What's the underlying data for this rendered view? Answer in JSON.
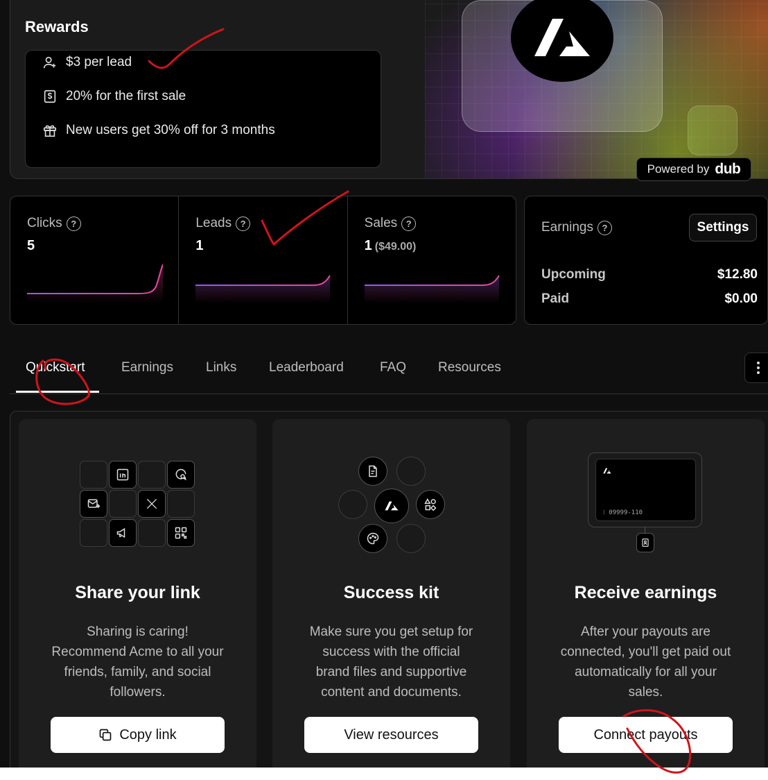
{
  "rewards": {
    "title": "Rewards",
    "items": [
      {
        "icon": "user-plus-icon",
        "text": "$3 per lead"
      },
      {
        "icon": "receipt-dollar-icon",
        "text": "20% for the first sale"
      },
      {
        "icon": "gift-icon",
        "text": "New users get 30% off for 3 months"
      }
    ]
  },
  "powered_by": {
    "label": "Powered by",
    "brand": "dub"
  },
  "stats": [
    {
      "label": "Clicks",
      "value": "5",
      "sub": ""
    },
    {
      "label": "Leads",
      "value": "1",
      "sub": ""
    },
    {
      "label": "Sales",
      "value": "1",
      "sub": "($49.00)"
    }
  ],
  "earnings": {
    "label": "Earnings",
    "settings_label": "Settings",
    "upcoming_label": "Upcoming",
    "upcoming_value": "$12.80",
    "paid_label": "Paid",
    "paid_value": "$0.00"
  },
  "tabs": [
    "Quickstart",
    "Earnings",
    "Links",
    "Leaderboard",
    "FAQ",
    "Resources"
  ],
  "active_tab": "Quickstart",
  "cards": [
    {
      "title": "Share your link",
      "desc": "Sharing is caring! Recommend Acme to all your friends, family, and social followers.",
      "button": "Copy link",
      "button_icon": "copy-icon"
    },
    {
      "title": "Success kit",
      "desc": "Make sure you get setup for success with the official brand files and supportive content and documents.",
      "button": "View resources"
    },
    {
      "title": "Receive earnings",
      "desc": "After your payouts are connected, you'll get paid out automatically for all your sales.",
      "button": "Connect payouts"
    }
  ],
  "bank_card": {
    "number": "09999-110"
  },
  "colors": {
    "accent_purple": "#8b5cf6",
    "accent_pink": "#ec4899",
    "annotation_red": "#d0141b"
  }
}
